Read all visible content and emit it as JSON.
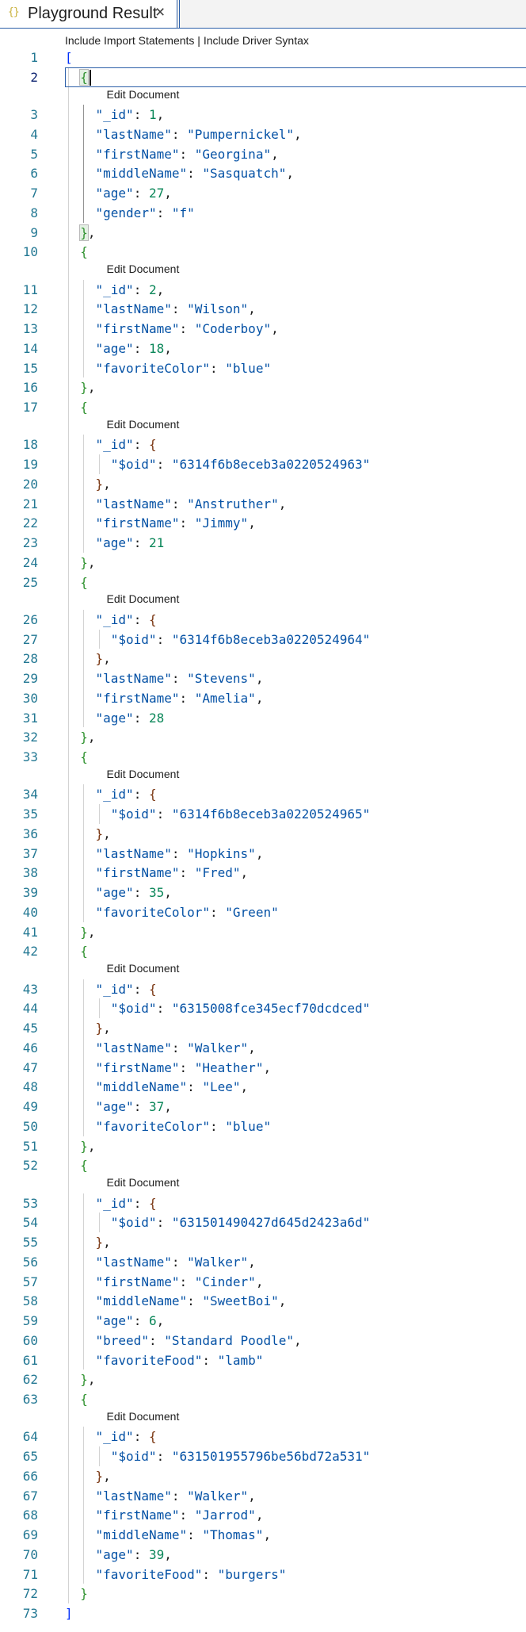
{
  "tab": {
    "icon": "{}",
    "title": "Playground Result",
    "close_icon": "×"
  },
  "codelens_top": {
    "import": "Include Import Statements",
    "separator": " | ",
    "driver": "Include Driver Syntax"
  },
  "edit_document_label": "Edit Document",
  "colors": {
    "key": "#0451a5",
    "number": "#098658",
    "bracket_level1": "#0431fa",
    "bracket_level2": "#319331",
    "bracket_level3": "#7b3814",
    "line_number": "#237893",
    "active_line_number": "#0b216f",
    "focus_border": "#2c5fa8"
  },
  "documents": [
    {
      "fields": [
        [
          "_id",
          1
        ],
        [
          "lastName",
          "Pumpernickel"
        ],
        [
          "firstName",
          "Georgina"
        ],
        [
          "middleName",
          "Sasquatch"
        ],
        [
          "age",
          27
        ],
        [
          "gender",
          "f"
        ]
      ]
    },
    {
      "fields": [
        [
          "_id",
          2
        ],
        [
          "lastName",
          "Wilson"
        ],
        [
          "firstName",
          "Coderboy"
        ],
        [
          "age",
          18
        ],
        [
          "favoriteColor",
          "blue"
        ]
      ]
    },
    {
      "oid": "6314f6b8eceb3a0220524963",
      "fields": [
        [
          "lastName",
          "Anstruther"
        ],
        [
          "firstName",
          "Jimmy"
        ],
        [
          "age",
          21
        ]
      ]
    },
    {
      "oid": "6314f6b8eceb3a0220524964",
      "fields": [
        [
          "lastName",
          "Stevens"
        ],
        [
          "firstName",
          "Amelia"
        ],
        [
          "age",
          28
        ]
      ]
    },
    {
      "oid": "6314f6b8eceb3a0220524965",
      "fields": [
        [
          "lastName",
          "Hopkins"
        ],
        [
          "firstName",
          "Fred"
        ],
        [
          "age",
          35
        ],
        [
          "favoriteColor",
          "Green"
        ]
      ]
    },
    {
      "oid": "6315008fce345ecf70dcdced",
      "fields": [
        [
          "lastName",
          "Walker"
        ],
        [
          "firstName",
          "Heather"
        ],
        [
          "middleName",
          "Lee"
        ],
        [
          "age",
          37
        ],
        [
          "favoriteColor",
          "blue"
        ]
      ]
    },
    {
      "oid": "631501490427d645d2423a6d",
      "fields": [
        [
          "lastName",
          "Walker"
        ],
        [
          "firstName",
          "Cinder"
        ],
        [
          "middleName",
          "SweetBoi"
        ],
        [
          "age",
          6
        ],
        [
          "breed",
          "Standard Poodle"
        ],
        [
          "favoriteFood",
          "lamb"
        ]
      ]
    },
    {
      "oid": "631501955796be56bd72a531",
      "fields": [
        [
          "lastName",
          "Walker"
        ],
        [
          "firstName",
          "Jarrod"
        ],
        [
          "middleName",
          "Thomas"
        ],
        [
          "age",
          39
        ],
        [
          "favoriteFood",
          "burgers"
        ]
      ]
    }
  ],
  "editor": {
    "active_line": 2
  }
}
